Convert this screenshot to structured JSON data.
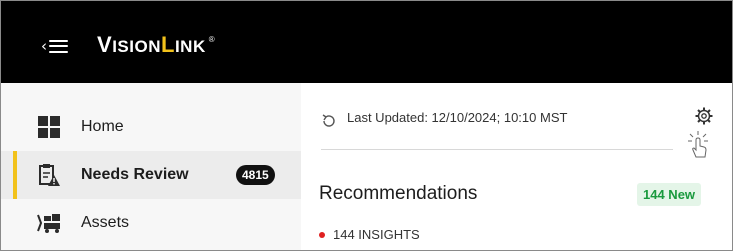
{
  "header": {
    "logo": {
      "part1_initial": "V",
      "part1_rest": "ISION",
      "part2_initial": "L",
      "part2_rest": "INK",
      "reg_mark": "®"
    },
    "menu_chevron": "‹"
  },
  "sidebar": {
    "items": [
      {
        "label": "Home",
        "icon": "grid-icon",
        "active": false
      },
      {
        "label": "Needs Review",
        "icon": "clipboard-icon",
        "active": true,
        "badge": "4815"
      },
      {
        "label": "Assets",
        "icon": "asset-icon",
        "active": false
      }
    ]
  },
  "main": {
    "last_updated": "Last Updated: 12/10/2024; 10:10 MST",
    "recommendations_title": "Recommendations",
    "new_badge": "144 New",
    "insights_label": "144 INSIGHTS"
  },
  "colors": {
    "topbar": "#000000",
    "accent": "#f2c21b",
    "new_badge_text": "#1a9a3e",
    "new_badge_bg": "#e4f5e8",
    "insight_dot": "#e02020"
  }
}
